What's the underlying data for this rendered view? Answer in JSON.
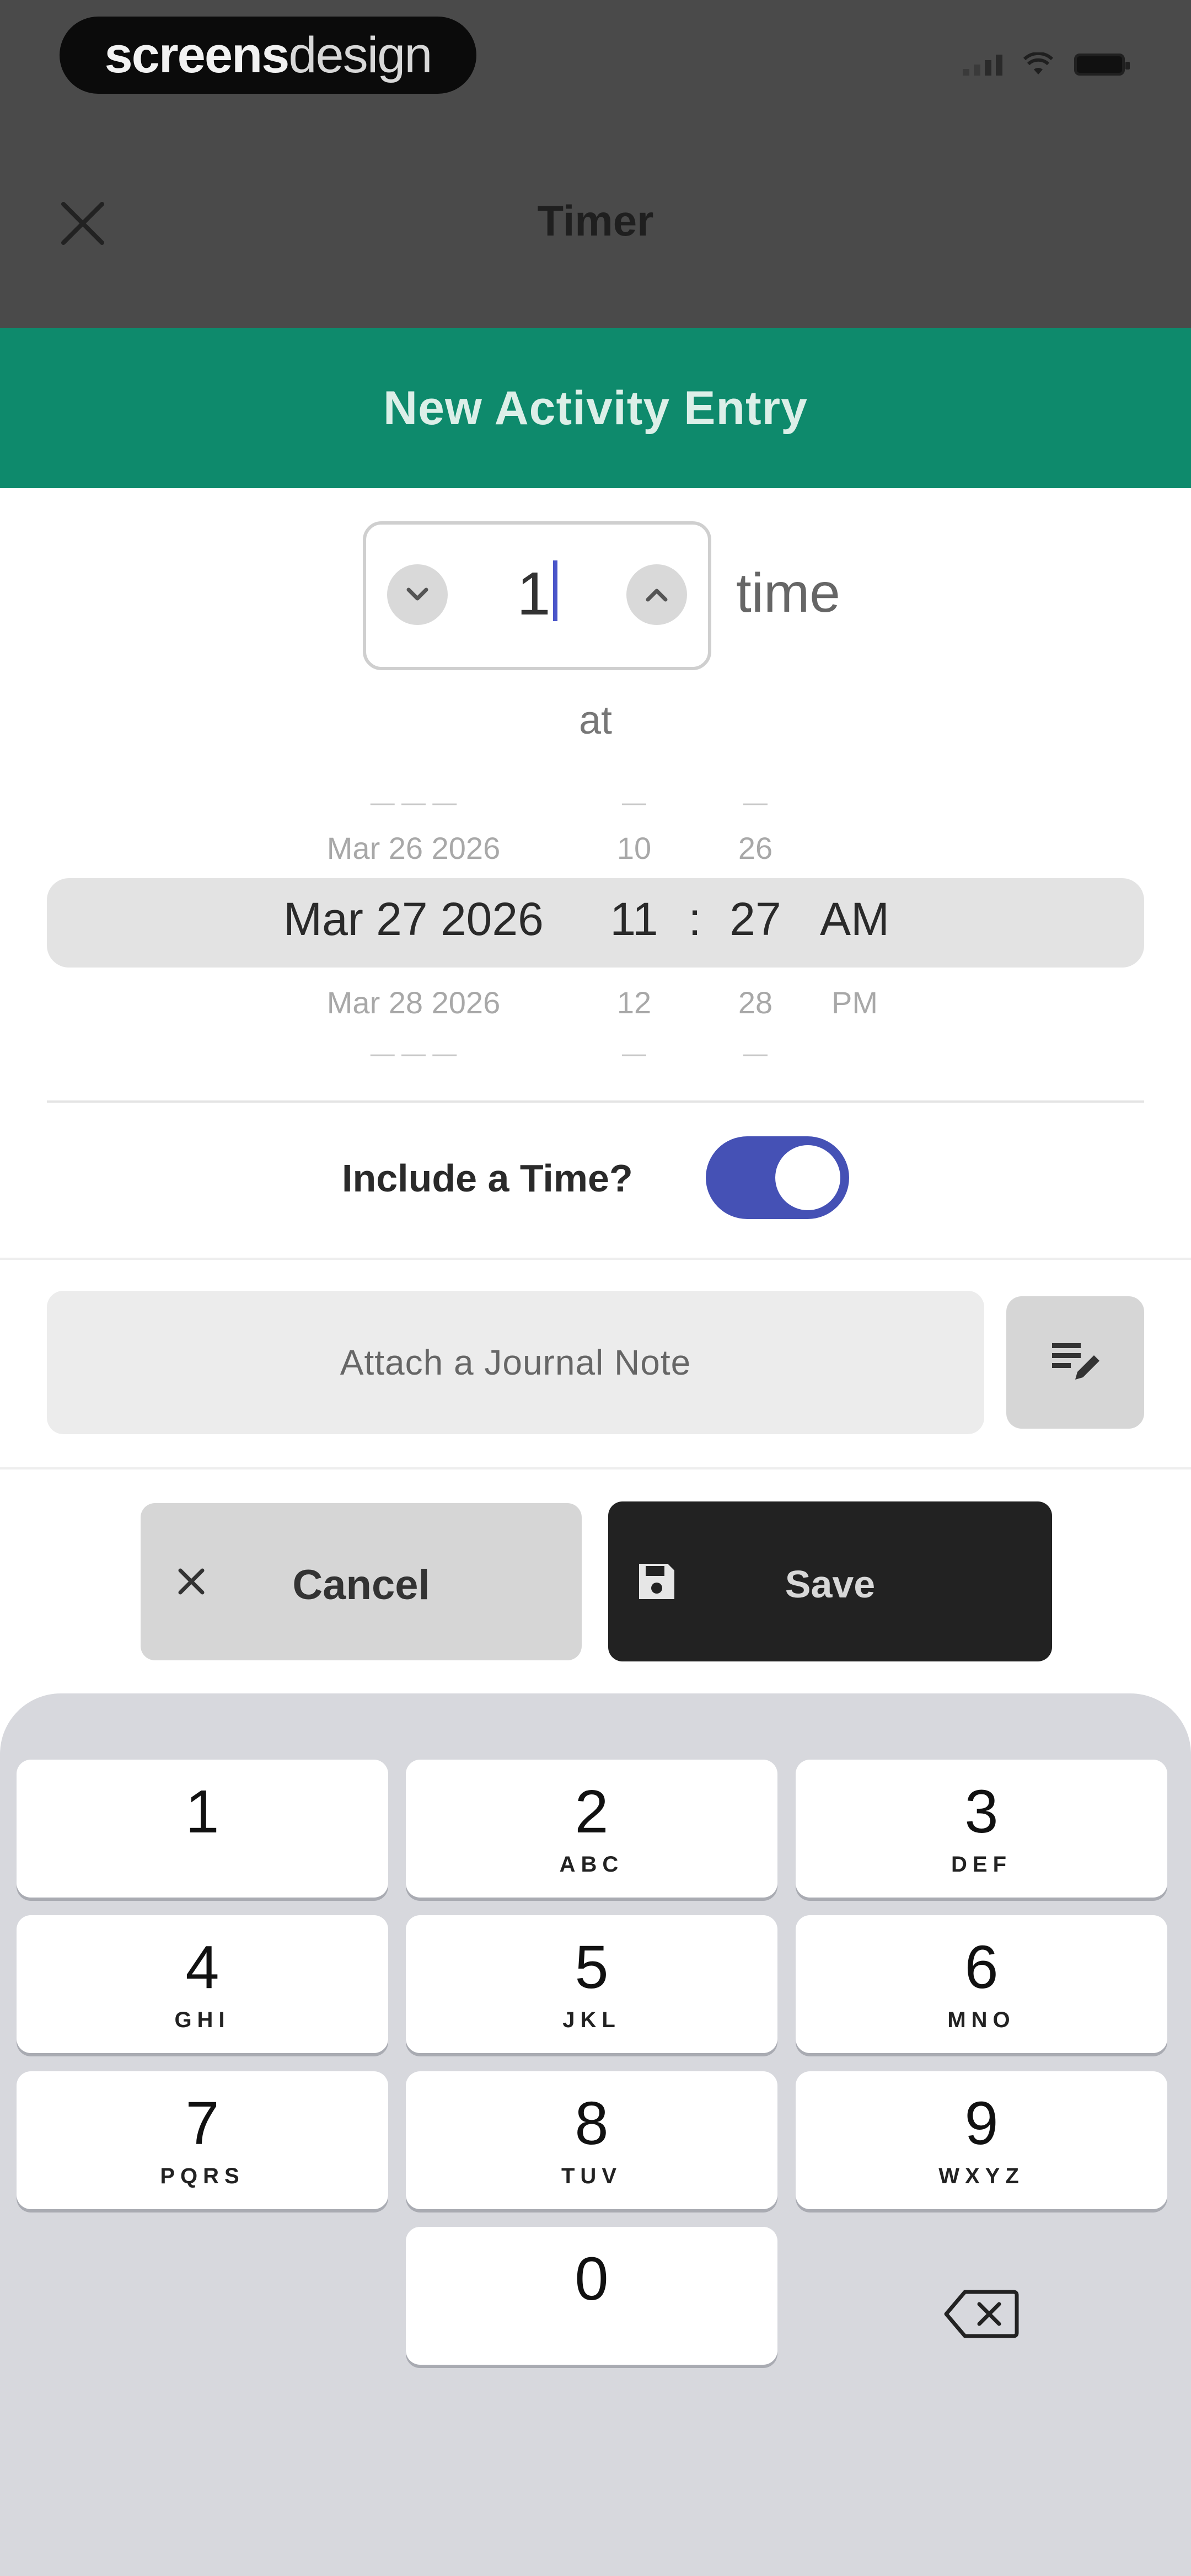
{
  "brand": {
    "bold": "screens",
    "light": "design"
  },
  "top_bar": {
    "title": "Timer"
  },
  "header": {
    "title": "New Activity Entry"
  },
  "quantity": {
    "value": "1",
    "unit": "time"
  },
  "connector": "at",
  "picker": {
    "previous": {
      "date": "Mar 26 2026",
      "hour": "10",
      "minute": "26",
      "ampm": ""
    },
    "selected": {
      "date": "Mar 27 2026",
      "hour": "11",
      "minute": "27",
      "ampm": "AM"
    },
    "next": {
      "date": "Mar 28 2026",
      "hour": "12",
      "minute": "28",
      "ampm": "PM"
    }
  },
  "include_time": {
    "label": "Include a Time?",
    "enabled": true
  },
  "journal": {
    "label": "Attach a Journal Note"
  },
  "actions": {
    "cancel": "Cancel",
    "save": "Save"
  },
  "keypad": {
    "keys": [
      {
        "num": "1",
        "letters": ""
      },
      {
        "num": "2",
        "letters": "ABC"
      },
      {
        "num": "3",
        "letters": "DEF"
      },
      {
        "num": "4",
        "letters": "GHI"
      },
      {
        "num": "5",
        "letters": "JKL"
      },
      {
        "num": "6",
        "letters": "MNO"
      },
      {
        "num": "7",
        "letters": "PQRS"
      },
      {
        "num": "8",
        "letters": "TUV"
      },
      {
        "num": "9",
        "letters": "WXYZ"
      },
      {
        "num": "0",
        "letters": ""
      }
    ]
  },
  "colors": {
    "header": "#0e8a6c",
    "toggle": "#4551b5",
    "save_button": "#222222",
    "cursor": "#4a55c9"
  }
}
